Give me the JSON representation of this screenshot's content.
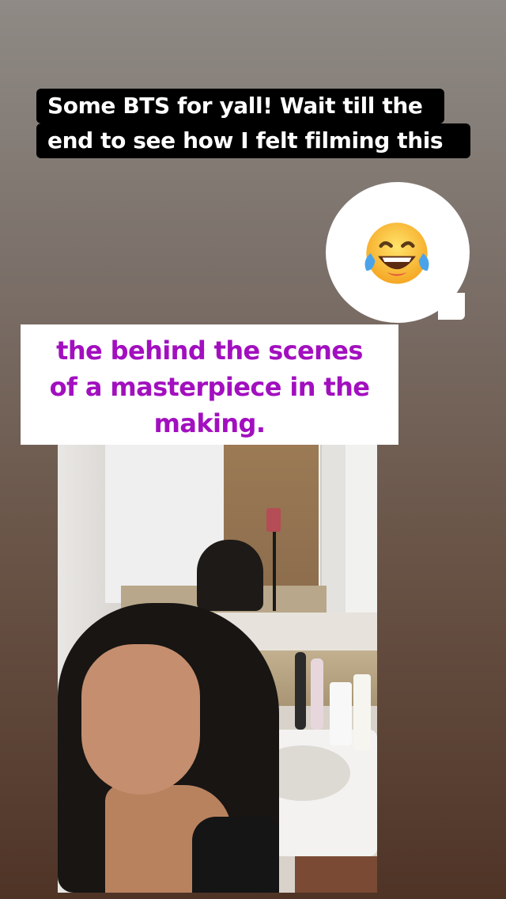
{
  "story": {
    "caption_lines": [
      "Some BTS for yall! Wait till the",
      "end to see how I felt filming this"
    ],
    "reaction_emoji": "face-with-tears-of-joy",
    "overlay_text_lines": [
      "the behind the scenes",
      "of a masterpiece in the",
      "making."
    ],
    "colors": {
      "caption_bg": "#000000",
      "caption_text": "#ffffff",
      "overlay_bg": "#ffffff",
      "overlay_text": "#a20fbf"
    }
  }
}
